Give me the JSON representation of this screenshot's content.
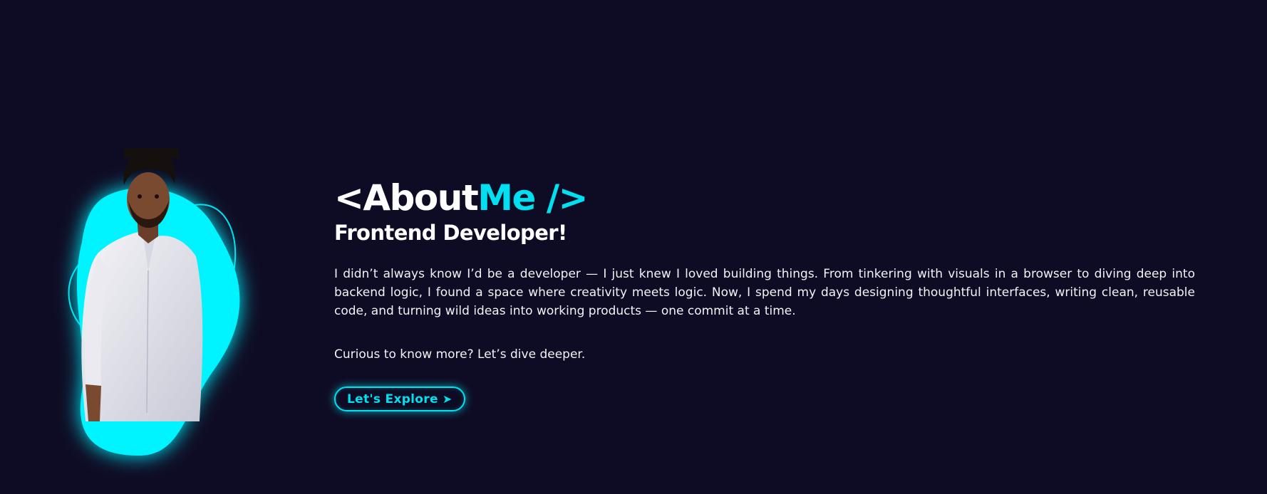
{
  "about": {
    "title_bracket_open": "<",
    "title_main": "About",
    "title_accent": "Me",
    "title_bracket_close": "/>",
    "subtitle": "Frontend Developer!",
    "bio": "I didn’t always know I’d be a developer — I just knew I loved building things. From tinkering with visuals in a browser to diving deep into backend logic, I found a space where creativity meets logic. Now, I spend my days designing thoughtful interfaces, writing clean, reusable code, and turning wild ideas into working products — one commit at a time.",
    "cta_text": "Curious to know more? Let’s dive deeper.",
    "explore_label": "Let's Explore",
    "explore_icon": "arrow-right-icon",
    "explore_arrow": "➤"
  },
  "colors": {
    "background": "#0e0c24",
    "accent": "#00e0f0",
    "text": "#ffffff"
  }
}
